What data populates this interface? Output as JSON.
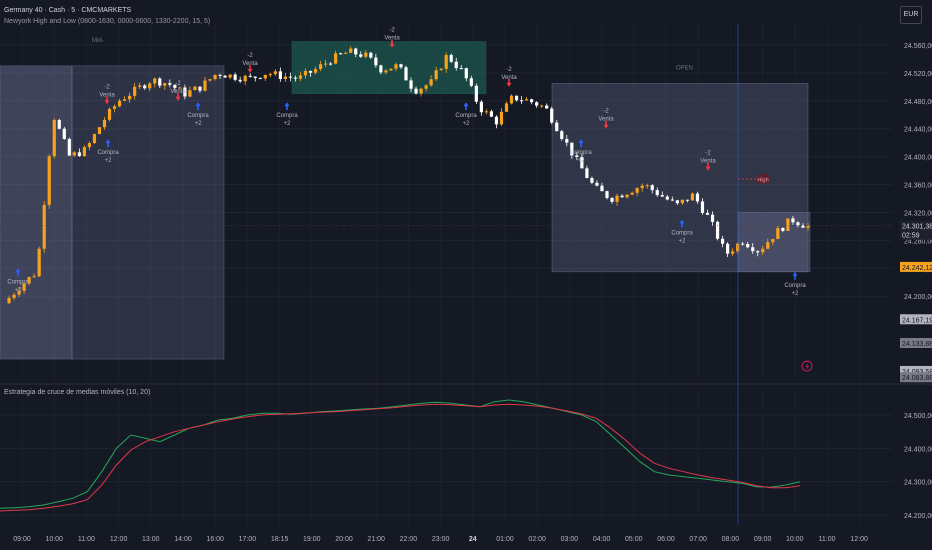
{
  "header": {
    "symbol_line": "Germany 40 · Cash · 5 · CMCMARKETS",
    "indicator_line": "Newyork High and Low (0800-1630, 0000-0600, 1330-2200, 15, 5)"
  },
  "currency": "EUR",
  "sub_indicator_title": "Estrategia de cruce de medias móviles (10, 20)",
  "session_tags": [
    "Mid-",
    "OPEN"
  ],
  "colors": {
    "background": "#151924",
    "candle_up": "#f7a21b",
    "candle_down": "#ffffff",
    "session_box": "#7a7fa6",
    "session_box_alt": "#1f6b5e",
    "buy_arrow": "#2962ff",
    "sell_arrow": "#f23645",
    "ma_fast": "#26a65b",
    "ma_slow": "#e0384b",
    "crosshair": "#2962ff"
  },
  "chart_data": [
    {
      "type": "candlestick",
      "title": "Germany 40 · Cash · 5 · CMCMARKETS",
      "x_ticks": [
        "09:00",
        "10:00",
        "11:00",
        "12:00",
        "13:00",
        "14:00",
        "16:00",
        "17:00",
        "18:15",
        "19:00",
        "20:00",
        "21:00",
        "22:00",
        "23:00",
        "24",
        "01:00",
        "02:00",
        "03:00",
        "04:00",
        "05:00",
        "06:00",
        "07:00",
        "08:00",
        "09:00",
        "10:00",
        "11:00",
        "12:00"
      ],
      "y_ticks": [
        24560,
        24520,
        24480,
        24440,
        24400,
        24360,
        24320,
        24280,
        24240,
        24200
      ],
      "y_tick_labels": [
        "24.560,00",
        "24.520,00",
        "24.480,00",
        "24.440,00",
        "24.400,00",
        "24.360,00",
        "24.320,00",
        "24.280,00",
        "24.240,00",
        "24.200,00"
      ],
      "ylim": [
        24080,
        24590
      ],
      "approx_close_path": [
        [
          0,
          24190
        ],
        [
          1,
          24215
        ],
        [
          2,
          24235
        ],
        [
          3,
          24460
        ],
        [
          4,
          24400
        ],
        [
          5,
          24410
        ],
        [
          6,
          24450
        ],
        [
          7,
          24480
        ],
        [
          8,
          24495
        ],
        [
          9,
          24510
        ],
        [
          10,
          24505
        ],
        [
          11,
          24490
        ],
        [
          12,
          24500
        ],
        [
          13,
          24520
        ],
        [
          14,
          24515
        ],
        [
          15,
          24512
        ],
        [
          16,
          24520
        ],
        [
          17,
          24515
        ],
        [
          18,
          24512
        ],
        [
          19,
          24525
        ],
        [
          20,
          24540
        ],
        [
          21,
          24550
        ],
        [
          22,
          24545
        ],
        [
          23,
          24525
        ],
        [
          24,
          24530
        ],
        [
          25,
          24495
        ],
        [
          26,
          24505
        ],
        [
          27,
          24545
        ],
        [
          28,
          24520
        ],
        [
          29,
          24470
        ],
        [
          30,
          24450
        ],
        [
          31,
          24485
        ],
        [
          32,
          24480
        ],
        [
          33,
          24470
        ],
        [
          34,
          24430
        ],
        [
          35,
          24390
        ],
        [
          36,
          24355
        ],
        [
          37,
          24340
        ],
        [
          38,
          24350
        ],
        [
          39,
          24360
        ],
        [
          40,
          24345
        ],
        [
          41,
          24330
        ],
        [
          42,
          24345
        ],
        [
          43,
          24310
        ],
        [
          44,
          24260
        ],
        [
          45,
          24280
        ],
        [
          46,
          24265
        ],
        [
          47,
          24290
        ],
        [
          48,
          24310
        ],
        [
          49,
          24300
        ]
      ],
      "signals": [
        {
          "kind": "buy",
          "label_top": "Compra",
          "label_bottom": "+2"
        },
        {
          "kind": "sell",
          "label_top": "-2",
          "label_bottom": "Venta"
        }
      ],
      "session_high_label": "High",
      "price_labels": [
        "24.301,38",
        "02:59",
        "24.242,12",
        "24.167,19",
        "24.133,88",
        "24.093,58",
        "24.083,88"
      ]
    },
    {
      "type": "line",
      "title": "Estrategia de cruce de medias móviles (10, 20)",
      "y_ticks": [
        24500,
        24400,
        24300,
        24200
      ],
      "y_tick_labels": [
        "24.500,00",
        "24.400,00",
        "24.300,00",
        "24.200,00"
      ],
      "ylim": [
        24170,
        24560
      ],
      "series": [
        {
          "values": [
            24220,
            24222,
            24225,
            24230,
            24240,
            24250,
            24270,
            24330,
            24400,
            24440,
            24430,
            24420,
            24440,
            24460,
            24470,
            24485,
            24490,
            24500,
            24505,
            24505,
            24502,
            24505,
            24510,
            24512,
            24515,
            24518,
            24520,
            24525,
            24530,
            24535,
            24538,
            24535,
            24530,
            24525,
            24540,
            24545,
            24540,
            24530,
            24520,
            24510,
            24500,
            24480,
            24440,
            24400,
            24360,
            24330,
            24320,
            24315,
            24310,
            24305,
            24300,
            24295,
            24285,
            24283,
            24290,
            24300
          ]
        },
        {
          "values": [
            24212,
            24214,
            24216,
            24220,
            24226,
            24234,
            24246,
            24290,
            24350,
            24395,
            24420,
            24435,
            24450,
            24460,
            24470,
            24480,
            24488,
            24495,
            24500,
            24502,
            24504,
            24506,
            24508,
            24510,
            24513,
            24516,
            24519,
            24522,
            24526,
            24530,
            24532,
            24531,
            24528,
            24525,
            24530,
            24532,
            24530,
            24526,
            24520,
            24512,
            24503,
            24490,
            24460,
            24425,
            24385,
            24355,
            24340,
            24330,
            24320,
            24312,
            24305,
            24298,
            24288,
            24282,
            24282,
            24288
          ]
        }
      ]
    }
  ]
}
